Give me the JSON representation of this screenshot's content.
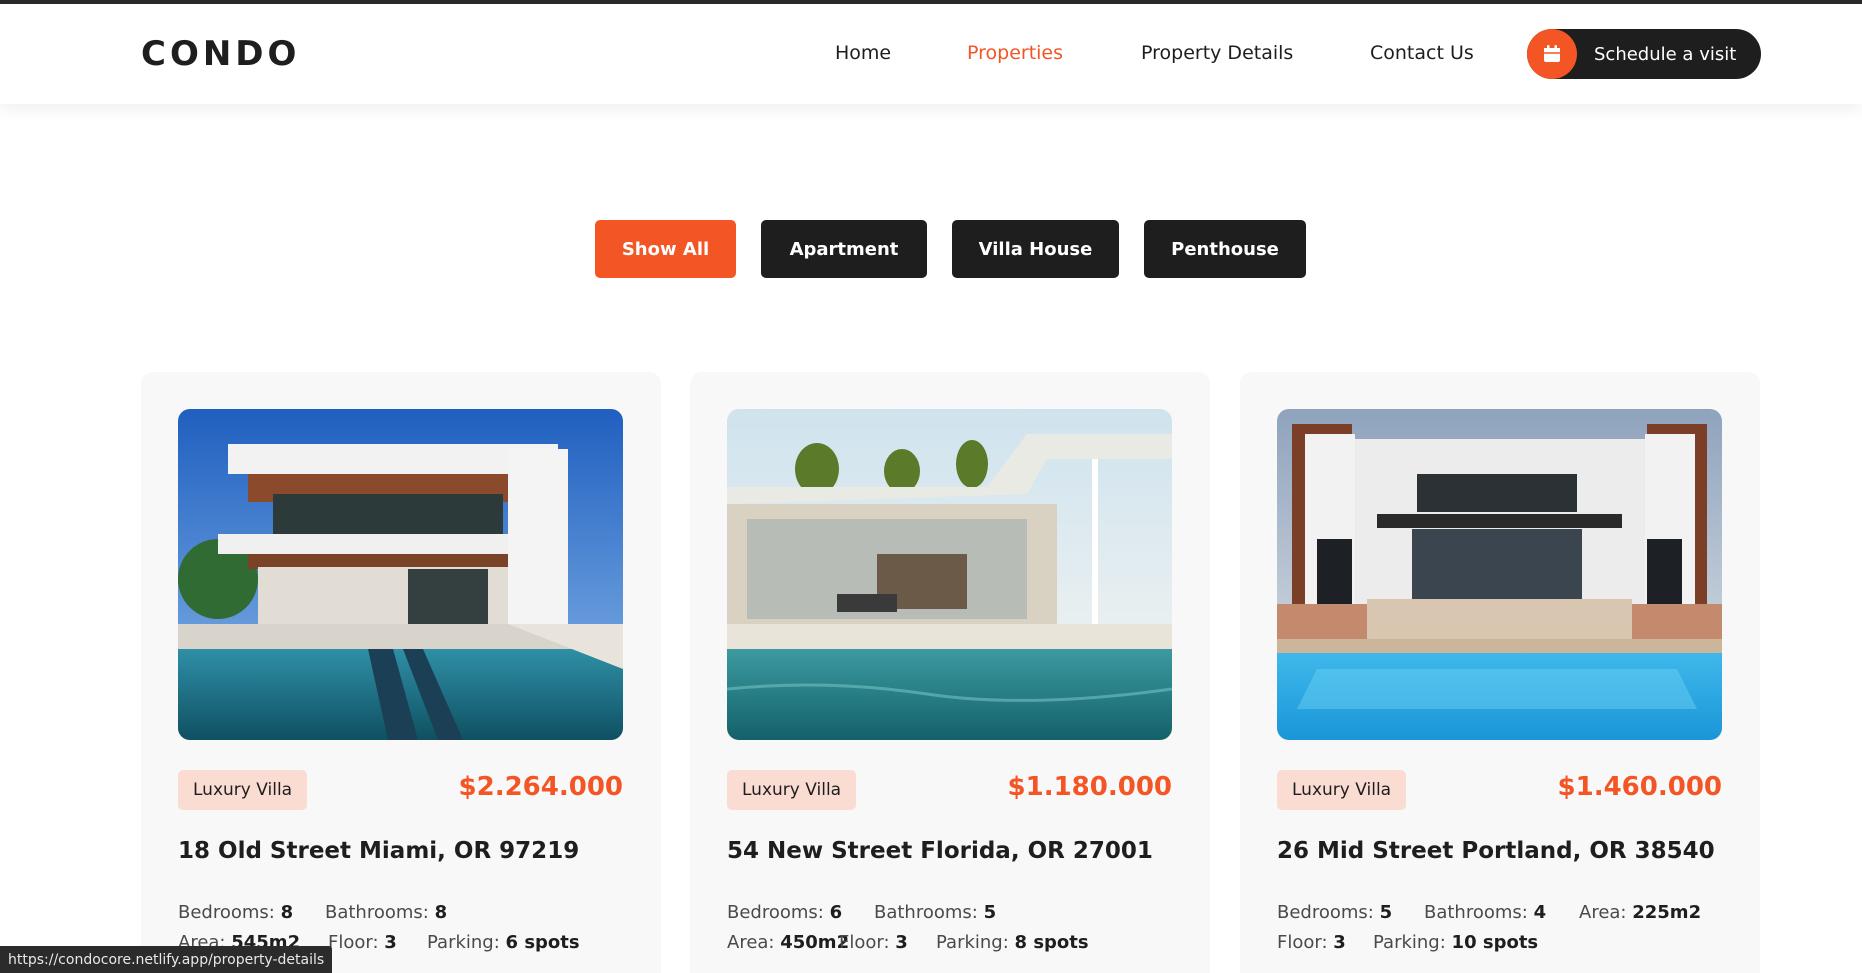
{
  "brand": {
    "logo": "CONDO"
  },
  "nav": {
    "items": [
      {
        "label": "Home"
      },
      {
        "label": "Properties"
      },
      {
        "label": "Property Details"
      },
      {
        "label": "Contact Us"
      }
    ],
    "cta_label": "Schedule a visit"
  },
  "filters": [
    "Show All",
    "Apartment",
    "Villa House",
    "Penthouse"
  ],
  "spec_labels": {
    "bedrooms": "Bedrooms:",
    "bathrooms": "Bathrooms:",
    "area": "Area:",
    "floor": "Floor:",
    "parking": "Parking:"
  },
  "properties": [
    {
      "tag": "Luxury Villa",
      "price": "$2.264.000",
      "title": "18 Old Street Miami, OR 97219",
      "bedrooms": "8",
      "bathrooms": "8",
      "area": "545m2",
      "floor": "3",
      "parking": "6 spots"
    },
    {
      "tag": "Luxury Villa",
      "price": "$1.180.000",
      "title": "54 New Street Florida, OR 27001",
      "bedrooms": "6",
      "bathrooms": "5",
      "area": "450m2",
      "floor": "3",
      "parking": "8 spots"
    },
    {
      "tag": "Luxury Villa",
      "price": "$1.460.000",
      "title": "26 Mid Street Portland, OR 38540",
      "bedrooms": "5",
      "bathrooms": "4",
      "area": "225m2",
      "floor": "3",
      "parking": "10 spots"
    }
  ],
  "status_bar": {
    "url": "https://condocore.netlify.app/property-details"
  },
  "colors": {
    "accent": "#f35525",
    "dark": "#1e1e1e",
    "tag_bg": "#fadcd3",
    "card_bg": "#f8f8f8"
  }
}
